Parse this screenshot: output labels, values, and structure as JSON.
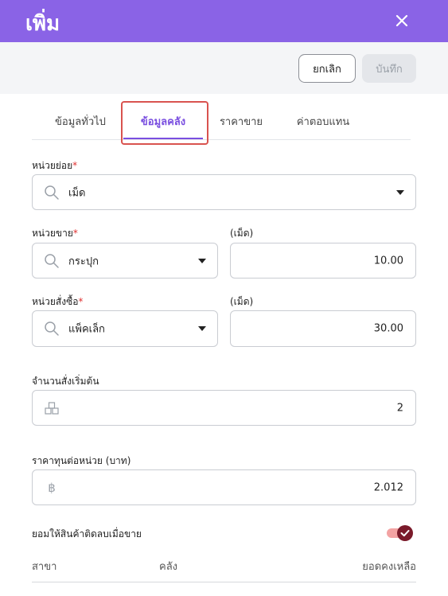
{
  "header": {
    "title": "เพิ่ม"
  },
  "toolbar": {
    "cancel_label": "ยกเลิก",
    "save_label": "บันทึก"
  },
  "tabs": [
    {
      "label": "ข้อมูลทั่วไป",
      "active": false
    },
    {
      "label": "ข้อมูลคลัง",
      "active": true
    },
    {
      "label": "ราคาขาย",
      "active": false
    },
    {
      "label": "ค่าตอบแทน",
      "active": false
    }
  ],
  "form": {
    "sub_unit": {
      "label": "หน่วยย่อย",
      "required_mark": "*",
      "value": "เม็ด"
    },
    "sale_unit": {
      "label": "หน่วยขาย",
      "required_mark": "*",
      "value": "กระปุก",
      "qty_label": "(เม็ด)",
      "qty_value": "10.00"
    },
    "purchase_unit": {
      "label": "หน่วยสั่งซื้อ",
      "required_mark": "*",
      "value": "แพ็คเล็ก",
      "qty_label": "(เม็ด)",
      "qty_value": "30.00"
    },
    "min_order": {
      "label": "จำนวนสั่งเริ่มต้น",
      "value": "2"
    },
    "unit_cost": {
      "label": "ราคาทุนต่อหน่วย (บาท)",
      "value": "2.012"
    },
    "allow_negative": {
      "label": "ยอมให้สินค้าติดลบเมื่อขาย",
      "enabled": true
    }
  },
  "table": {
    "columns": [
      "สาขา",
      "คลัง",
      "ยอดคงเหลือ"
    ]
  },
  "colors": {
    "header": "#8a63e6",
    "accent": "#7a4fe0",
    "required": "#e03131",
    "highlight": "#d9534f",
    "toggle_on": "#7a1a2a"
  }
}
